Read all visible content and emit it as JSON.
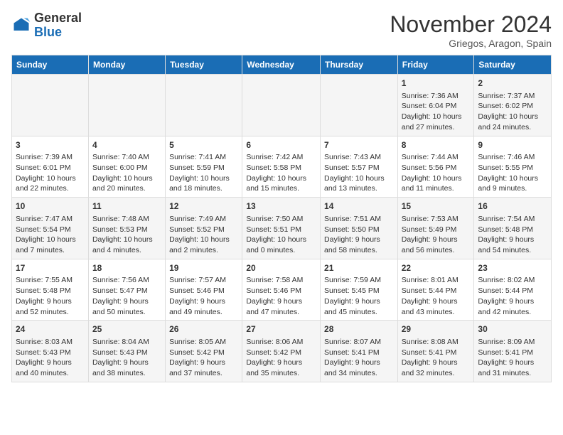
{
  "header": {
    "logo_general": "General",
    "logo_blue": "Blue",
    "month_title": "November 2024",
    "subtitle": "Griegos, Aragon, Spain"
  },
  "weekdays": [
    "Sunday",
    "Monday",
    "Tuesday",
    "Wednesday",
    "Thursday",
    "Friday",
    "Saturday"
  ],
  "weeks": [
    [
      {
        "day": "",
        "info": ""
      },
      {
        "day": "",
        "info": ""
      },
      {
        "day": "",
        "info": ""
      },
      {
        "day": "",
        "info": ""
      },
      {
        "day": "",
        "info": ""
      },
      {
        "day": "1",
        "info": "Sunrise: 7:36 AM\nSunset: 6:04 PM\nDaylight: 10 hours and 27 minutes."
      },
      {
        "day": "2",
        "info": "Sunrise: 7:37 AM\nSunset: 6:02 PM\nDaylight: 10 hours and 24 minutes."
      }
    ],
    [
      {
        "day": "3",
        "info": "Sunrise: 7:39 AM\nSunset: 6:01 PM\nDaylight: 10 hours and 22 minutes."
      },
      {
        "day": "4",
        "info": "Sunrise: 7:40 AM\nSunset: 6:00 PM\nDaylight: 10 hours and 20 minutes."
      },
      {
        "day": "5",
        "info": "Sunrise: 7:41 AM\nSunset: 5:59 PM\nDaylight: 10 hours and 18 minutes."
      },
      {
        "day": "6",
        "info": "Sunrise: 7:42 AM\nSunset: 5:58 PM\nDaylight: 10 hours and 15 minutes."
      },
      {
        "day": "7",
        "info": "Sunrise: 7:43 AM\nSunset: 5:57 PM\nDaylight: 10 hours and 13 minutes."
      },
      {
        "day": "8",
        "info": "Sunrise: 7:44 AM\nSunset: 5:56 PM\nDaylight: 10 hours and 11 minutes."
      },
      {
        "day": "9",
        "info": "Sunrise: 7:46 AM\nSunset: 5:55 PM\nDaylight: 10 hours and 9 minutes."
      }
    ],
    [
      {
        "day": "10",
        "info": "Sunrise: 7:47 AM\nSunset: 5:54 PM\nDaylight: 10 hours and 7 minutes."
      },
      {
        "day": "11",
        "info": "Sunrise: 7:48 AM\nSunset: 5:53 PM\nDaylight: 10 hours and 4 minutes."
      },
      {
        "day": "12",
        "info": "Sunrise: 7:49 AM\nSunset: 5:52 PM\nDaylight: 10 hours and 2 minutes."
      },
      {
        "day": "13",
        "info": "Sunrise: 7:50 AM\nSunset: 5:51 PM\nDaylight: 10 hours and 0 minutes."
      },
      {
        "day": "14",
        "info": "Sunrise: 7:51 AM\nSunset: 5:50 PM\nDaylight: 9 hours and 58 minutes."
      },
      {
        "day": "15",
        "info": "Sunrise: 7:53 AM\nSunset: 5:49 PM\nDaylight: 9 hours and 56 minutes."
      },
      {
        "day": "16",
        "info": "Sunrise: 7:54 AM\nSunset: 5:48 PM\nDaylight: 9 hours and 54 minutes."
      }
    ],
    [
      {
        "day": "17",
        "info": "Sunrise: 7:55 AM\nSunset: 5:48 PM\nDaylight: 9 hours and 52 minutes."
      },
      {
        "day": "18",
        "info": "Sunrise: 7:56 AM\nSunset: 5:47 PM\nDaylight: 9 hours and 50 minutes."
      },
      {
        "day": "19",
        "info": "Sunrise: 7:57 AM\nSunset: 5:46 PM\nDaylight: 9 hours and 49 minutes."
      },
      {
        "day": "20",
        "info": "Sunrise: 7:58 AM\nSunset: 5:46 PM\nDaylight: 9 hours and 47 minutes."
      },
      {
        "day": "21",
        "info": "Sunrise: 7:59 AM\nSunset: 5:45 PM\nDaylight: 9 hours and 45 minutes."
      },
      {
        "day": "22",
        "info": "Sunrise: 8:01 AM\nSunset: 5:44 PM\nDaylight: 9 hours and 43 minutes."
      },
      {
        "day": "23",
        "info": "Sunrise: 8:02 AM\nSunset: 5:44 PM\nDaylight: 9 hours and 42 minutes."
      }
    ],
    [
      {
        "day": "24",
        "info": "Sunrise: 8:03 AM\nSunset: 5:43 PM\nDaylight: 9 hours and 40 minutes."
      },
      {
        "day": "25",
        "info": "Sunrise: 8:04 AM\nSunset: 5:43 PM\nDaylight: 9 hours and 38 minutes."
      },
      {
        "day": "26",
        "info": "Sunrise: 8:05 AM\nSunset: 5:42 PM\nDaylight: 9 hours and 37 minutes."
      },
      {
        "day": "27",
        "info": "Sunrise: 8:06 AM\nSunset: 5:42 PM\nDaylight: 9 hours and 35 minutes."
      },
      {
        "day": "28",
        "info": "Sunrise: 8:07 AM\nSunset: 5:41 PM\nDaylight: 9 hours and 34 minutes."
      },
      {
        "day": "29",
        "info": "Sunrise: 8:08 AM\nSunset: 5:41 PM\nDaylight: 9 hours and 32 minutes."
      },
      {
        "day": "30",
        "info": "Sunrise: 8:09 AM\nSunset: 5:41 PM\nDaylight: 9 hours and 31 minutes."
      }
    ]
  ]
}
